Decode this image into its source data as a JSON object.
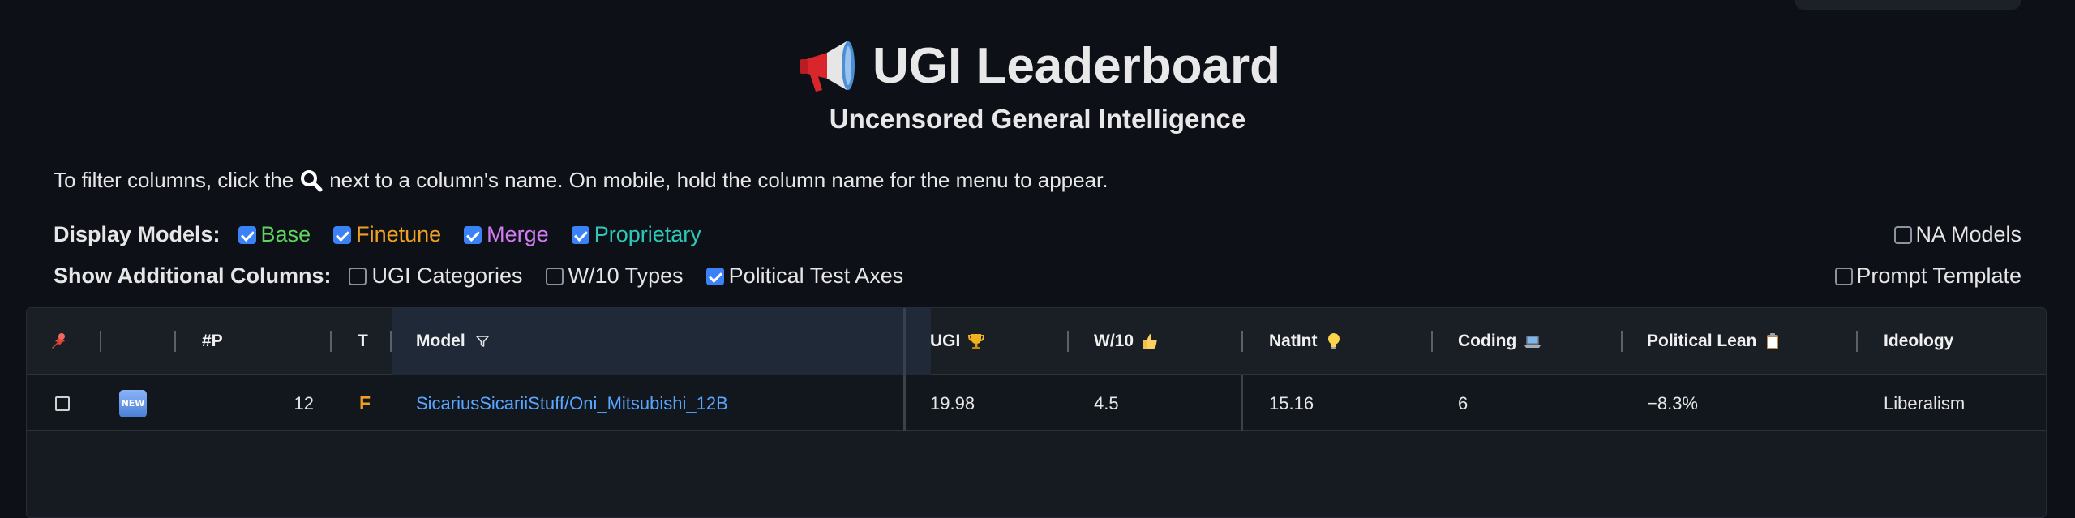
{
  "header": {
    "title": "UGI Leaderboard",
    "subtitle": "Uncensored General Intelligence"
  },
  "instructions": {
    "before": "To filter columns, click the",
    "after": "next to a column's name. On mobile, hold the column name for the menu to appear."
  },
  "display_models": {
    "label": "Display Models:",
    "options": [
      {
        "label": "Base",
        "checked": true,
        "color": "#5fd35f"
      },
      {
        "label": "Finetune",
        "checked": true,
        "color": "#f0a020"
      },
      {
        "label": "Merge",
        "checked": true,
        "color": "#d17cf0"
      },
      {
        "label": "Proprietary",
        "checked": true,
        "color": "#2cc9b8"
      }
    ],
    "na_models": {
      "label": "NA Models",
      "checked": false
    }
  },
  "additional_columns": {
    "label": "Show Additional Columns:",
    "options": [
      {
        "label": "UGI Categories",
        "checked": false
      },
      {
        "label": "W/10 Types",
        "checked": false
      },
      {
        "label": "Political Test Axes",
        "checked": true
      }
    ],
    "prompt_template": {
      "label": "Prompt Template",
      "checked": false
    }
  },
  "table": {
    "headers": {
      "params": "#P",
      "type": "T",
      "model": "Model",
      "ugi": "UGI",
      "w10": "W/10",
      "natint": "NatInt",
      "coding": "Coding",
      "political_lean": "Political Lean",
      "ideology": "Ideology"
    },
    "rows": [
      {
        "badge": "NEW",
        "params": "12",
        "type": "F",
        "model": "SicariusSicariiStuff/Oni_Mitsubishi_12B",
        "ugi": "19.98",
        "w10": "4.5",
        "natint": "15.16",
        "coding": "6",
        "political_lean": "−8.3%",
        "ideology": "Liberalism"
      }
    ]
  }
}
